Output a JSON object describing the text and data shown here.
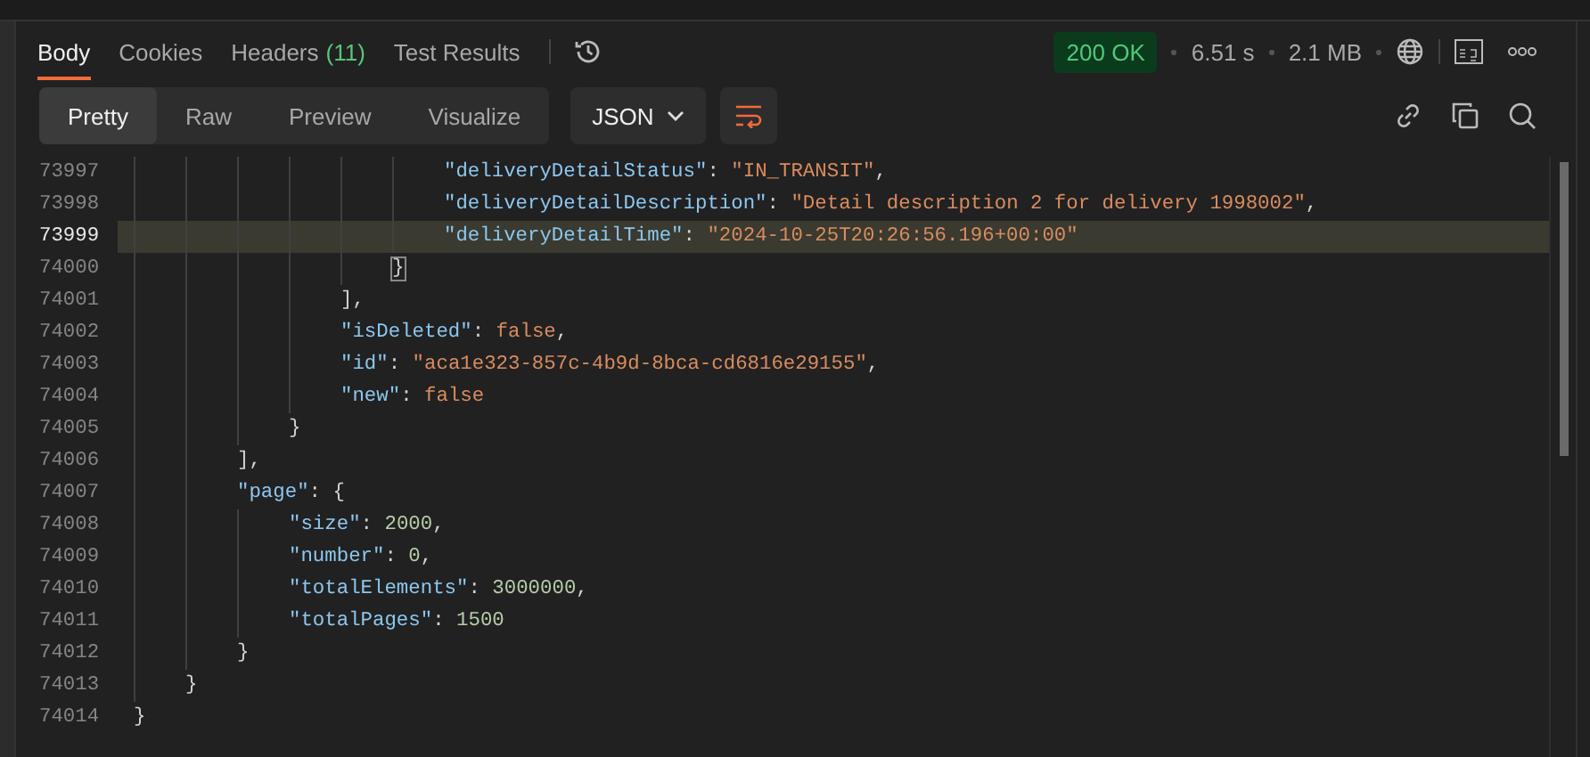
{
  "response_tabs": [
    {
      "label": "Body",
      "selected": true
    },
    {
      "label": "Cookies",
      "selected": false
    },
    {
      "label": "Headers",
      "count": "(11)",
      "selected": false
    },
    {
      "label": "Test Results",
      "selected": false
    }
  ],
  "status": {
    "code": "200 OK",
    "time": "6.51 s",
    "size": "2.1 MB"
  },
  "view_modes": [
    {
      "label": "Pretty",
      "selected": true
    },
    {
      "label": "Raw",
      "selected": false
    },
    {
      "label": "Preview",
      "selected": false
    },
    {
      "label": "Visualize",
      "selected": false
    }
  ],
  "format_dropdown": {
    "value": "JSON"
  },
  "code": [
    {
      "children": [
        {
          "children": [
            {
              "children": [
                {
                  "children": [
                    {
                      "children": [
                        {
                          "children": [
                            {
                              "number": "73997",
                              "highlighted": false,
                              "tokens": [
                                {
                                  "kind": "key",
                                  "text": "\"deliveryDetailStatus\""
                                },
                                {
                                  "kind": "punct",
                                  "text": ": "
                                },
                                {
                                  "kind": "string",
                                  "text": "\"IN_TRANSIT\""
                                },
                                {
                                  "kind": "punct",
                                  "text": ","
                                }
                              ]
                            },
                            {
                              "number": "73998",
                              "highlighted": false,
                              "tokens": [
                                {
                                  "kind": "key",
                                  "text": "\"deliveryDetailDescription\""
                                },
                                {
                                  "kind": "punct",
                                  "text": ": "
                                },
                                {
                                  "kind": "string",
                                  "text": "\"Detail description 2 for delivery 1998002\""
                                },
                                {
                                  "kind": "punct",
                                  "text": ","
                                }
                              ]
                            },
                            {
                              "number": "73999",
                              "highlighted": true,
                              "tokens": [
                                {
                                  "kind": "key",
                                  "text": "\"deliveryDetailTime\""
                                },
                                {
                                  "kind": "punct",
                                  "text": ": "
                                },
                                {
                                  "kind": "string",
                                  "text": "\"2024-10-25T20:26:56.196+00:00\""
                                }
                              ]
                            }
                          ]
                        },
                        {
                          "number": "74000",
                          "highlighted": false,
                          "tokens": [
                            {
                              "kind": "matched",
                              "text": "}"
                            }
                          ]
                        }
                      ]
                    },
                    {
                      "number": "74001",
                      "highlighted": false,
                      "tokens": [
                        {
                          "kind": "punct",
                          "text": "],"
                        }
                      ]
                    },
                    {
                      "number": "74002",
                      "highlighted": false,
                      "tokens": [
                        {
                          "kind": "key",
                          "text": "\"isDeleted\""
                        },
                        {
                          "kind": "punct",
                          "text": ": "
                        },
                        {
                          "kind": "bool",
                          "text": "false"
                        },
                        {
                          "kind": "punct",
                          "text": ","
                        }
                      ]
                    },
                    {
                      "number": "74003",
                      "highlighted": false,
                      "tokens": [
                        {
                          "kind": "key",
                          "text": "\"id\""
                        },
                        {
                          "kind": "punct",
                          "text": ": "
                        },
                        {
                          "kind": "string",
                          "text": "\"aca1e323-857c-4b9d-8bca-cd6816e29155\""
                        },
                        {
                          "kind": "punct",
                          "text": ","
                        }
                      ]
                    },
                    {
                      "number": "74004",
                      "highlighted": false,
                      "tokens": [
                        {
                          "kind": "key",
                          "text": "\"new\""
                        },
                        {
                          "kind": "punct",
                          "text": ": "
                        },
                        {
                          "kind": "bool",
                          "text": "false"
                        }
                      ]
                    }
                  ]
                },
                {
                  "number": "74005",
                  "highlighted": false,
                  "tokens": [
                    {
                      "kind": "punct",
                      "text": "}"
                    }
                  ]
                }
              ]
            },
            {
              "number": "74006",
              "highlighted": false,
              "tokens": [
                {
                  "kind": "punct",
                  "text": "],"
                }
              ]
            },
            {
              "number": "74007",
              "highlighted": false,
              "tokens": [
                {
                  "kind": "key",
                  "text": "\"page\""
                },
                {
                  "kind": "punct",
                  "text": ": {"
                }
              ]
            },
            {
              "children": [
                {
                  "number": "74008",
                  "highlighted": false,
                  "tokens": [
                    {
                      "kind": "key",
                      "text": "\"size\""
                    },
                    {
                      "kind": "punct",
                      "text": ": "
                    },
                    {
                      "kind": "number",
                      "text": "2000"
                    },
                    {
                      "kind": "punct",
                      "text": ","
                    }
                  ]
                },
                {
                  "number": "74009",
                  "highlighted": false,
                  "tokens": [
                    {
                      "kind": "key",
                      "text": "\"number\""
                    },
                    {
                      "kind": "punct",
                      "text": ": "
                    },
                    {
                      "kind": "number",
                      "text": "0"
                    },
                    {
                      "kind": "punct",
                      "text": ","
                    }
                  ]
                },
                {
                  "number": "74010",
                  "highlighted": false,
                  "tokens": [
                    {
                      "kind": "key",
                      "text": "\"totalElements\""
                    },
                    {
                      "kind": "punct",
                      "text": ": "
                    },
                    {
                      "kind": "number",
                      "text": "3000000"
                    },
                    {
                      "kind": "punct",
                      "text": ","
                    }
                  ]
                },
                {
                  "number": "74011",
                  "highlighted": false,
                  "tokens": [
                    {
                      "kind": "key",
                      "text": "\"totalPages\""
                    },
                    {
                      "kind": "punct",
                      "text": ": "
                    },
                    {
                      "kind": "number",
                      "text": "1500"
                    }
                  ]
                }
              ]
            },
            {
              "number": "74012",
              "highlighted": false,
              "tokens": [
                {
                  "kind": "punct",
                  "text": "}"
                }
              ]
            }
          ]
        },
        {
          "number": "74013",
          "highlighted": false,
          "tokens": [
            {
              "kind": "punct",
              "text": "}"
            }
          ]
        }
      ]
    },
    {
      "number": "74014",
      "highlighted": false,
      "tokens": [
        {
          "kind": "punct",
          "text": "}"
        }
      ]
    }
  ]
}
